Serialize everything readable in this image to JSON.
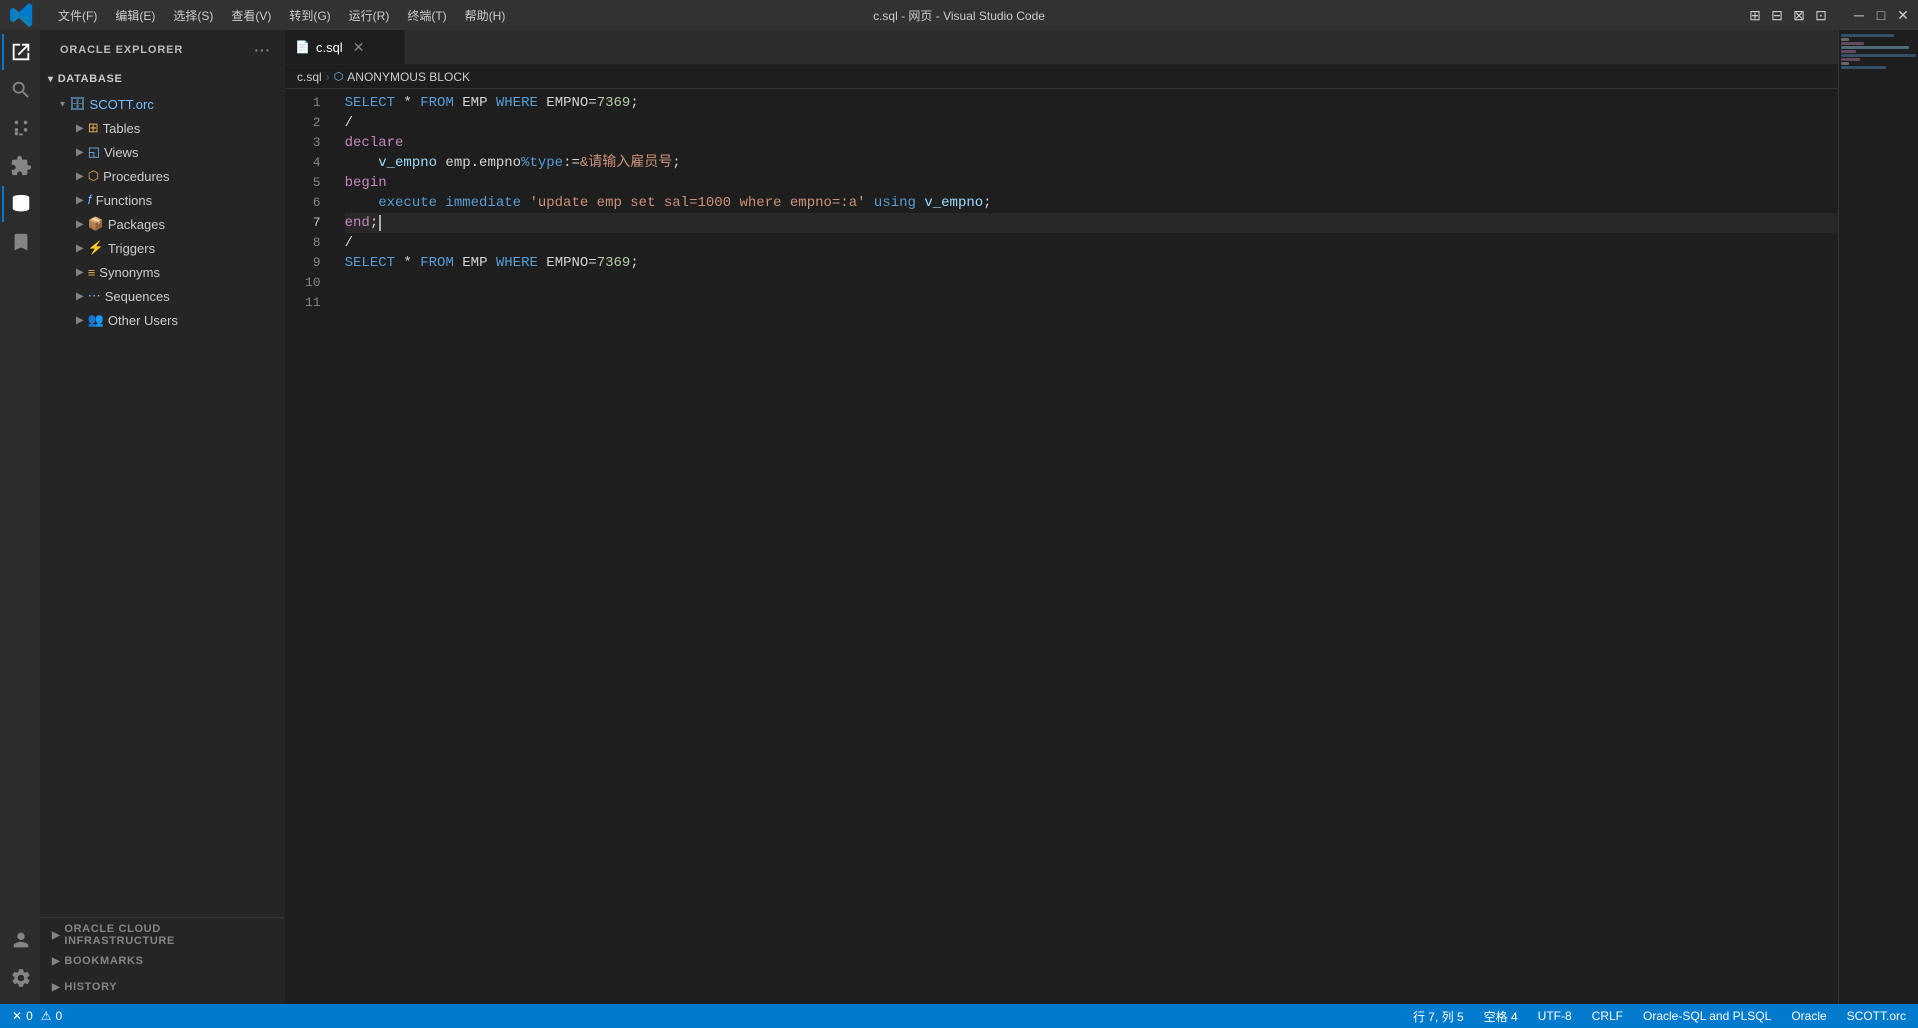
{
  "titlebar": {
    "menus": [
      "文件(F)",
      "编辑(E)",
      "选择(S)",
      "查看(V)",
      "转到(G)",
      "运行(R)",
      "终端(T)",
      "帮助(H)"
    ],
    "title": "c.sql - 网页 - Visual Studio Code"
  },
  "sidebar": {
    "header": "ORACLE EXPLORER",
    "database_label": "DATABASE",
    "tree": {
      "scott_label": "SCOTT.orc",
      "items": [
        {
          "label": "Tables",
          "icon": "table"
        },
        {
          "label": "Views",
          "icon": "view"
        },
        {
          "label": "Procedures",
          "icon": "proc"
        },
        {
          "label": "Functions",
          "icon": "func"
        },
        {
          "label": "Packages",
          "icon": "pkg"
        },
        {
          "label": "Triggers",
          "icon": "trig"
        },
        {
          "label": "Synonyms",
          "icon": "syn"
        },
        {
          "label": "Sequences",
          "icon": "seq"
        },
        {
          "label": "Other Users",
          "icon": "users"
        }
      ]
    }
  },
  "tab": {
    "name": "c.sql",
    "icon": "sql"
  },
  "breadcrumb": {
    "file": "c.sql",
    "symbol": "ANONYMOUS BLOCK"
  },
  "code": {
    "lines": [
      {
        "num": 1,
        "tokens": [
          {
            "t": "kw",
            "v": "SELECT"
          },
          {
            "t": "plain",
            "v": " * "
          },
          {
            "t": "kw",
            "v": "FROM"
          },
          {
            "t": "plain",
            "v": " EMP "
          },
          {
            "t": "kw",
            "v": "WHERE"
          },
          {
            "t": "plain",
            "v": " EMPNO="
          },
          {
            "t": "num",
            "v": "7369"
          },
          {
            "t": "plain",
            "v": ";"
          }
        ]
      },
      {
        "num": 2,
        "tokens": [
          {
            "t": "plain",
            "v": "/"
          }
        ]
      },
      {
        "num": 3,
        "tokens": [
          {
            "t": "kw2",
            "v": "declare"
          }
        ]
      },
      {
        "num": 4,
        "tokens": [
          {
            "t": "plain",
            "v": "    "
          },
          {
            "t": "var",
            "v": "v_empno"
          },
          {
            "t": "plain",
            "v": " emp.empno"
          },
          {
            "t": "kw",
            "v": "%type"
          },
          {
            "t": "plain",
            "v": ":="
          },
          {
            "t": "str",
            "v": "&请输入雇员号"
          },
          {
            "t": "plain",
            "v": ";"
          }
        ]
      },
      {
        "num": 5,
        "tokens": [
          {
            "t": "kw2",
            "v": "begin"
          }
        ]
      },
      {
        "num": 6,
        "tokens": [
          {
            "t": "plain",
            "v": "    "
          },
          {
            "t": "kw",
            "v": "execute immediate"
          },
          {
            "t": "plain",
            "v": " "
          },
          {
            "t": "str",
            "v": "'update emp set sal=1000 where empno=:a'"
          },
          {
            "t": "plain",
            "v": " "
          },
          {
            "t": "kw",
            "v": "using"
          },
          {
            "t": "plain",
            "v": " "
          },
          {
            "t": "var",
            "v": "v_empno"
          },
          {
            "t": "plain",
            "v": ";"
          }
        ]
      },
      {
        "num": 7,
        "tokens": [
          {
            "t": "kw2",
            "v": "end"
          },
          {
            "t": "plain",
            "v": ";"
          }
        ],
        "cursor": true
      },
      {
        "num": 8,
        "tokens": [
          {
            "t": "plain",
            "v": "/"
          }
        ]
      },
      {
        "num": 9,
        "tokens": [
          {
            "t": "kw",
            "v": "SELECT"
          },
          {
            "t": "plain",
            "v": " * "
          },
          {
            "t": "kw",
            "v": "FROM"
          },
          {
            "t": "plain",
            "v": " EMP "
          },
          {
            "t": "kw",
            "v": "WHERE"
          },
          {
            "t": "plain",
            "v": " EMPNO="
          },
          {
            "t": "num",
            "v": "7369"
          },
          {
            "t": "plain",
            "v": ";"
          }
        ]
      },
      {
        "num": 10,
        "tokens": []
      },
      {
        "num": 11,
        "tokens": []
      }
    ]
  },
  "statusbar": {
    "errors": "0",
    "warnings": "0",
    "position": "行 7, 列 5",
    "spaces": "空格 4",
    "encoding": "UTF-8",
    "eol": "CRLF",
    "language": "Oracle-SQL and PLSQL",
    "schema": "Oracle",
    "connection": "SCOTT.orc"
  },
  "bottom_panels": [
    {
      "label": "ORACLE CLOUD INFRASTRUCTURE"
    },
    {
      "label": "BOOKMARKS"
    },
    {
      "label": "HISTORY"
    }
  ]
}
